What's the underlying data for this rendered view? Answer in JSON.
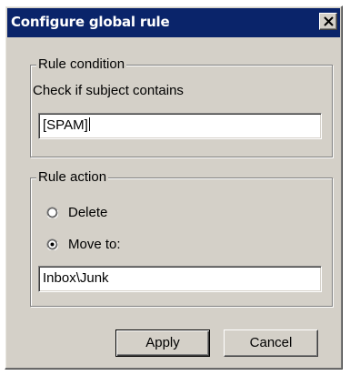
{
  "window": {
    "title": "Configure global rule"
  },
  "icons": {
    "close": "close-icon",
    "radio_delete": "radio-unchecked",
    "radio_move": "radio-checked"
  },
  "condition": {
    "legend": "Rule condition",
    "prompt": "Check if subject contains",
    "subject_value": "[SPAM]"
  },
  "action": {
    "legend": "Rule action",
    "delete_label": "Delete",
    "move_label": "Move to:",
    "selected": "move",
    "folder_value": "Inbox\\Junk"
  },
  "buttons": {
    "apply_label": "Apply",
    "cancel_label": "Cancel"
  },
  "colors": {
    "titlebar": "#0a246a",
    "face": "#d4d0c8"
  }
}
